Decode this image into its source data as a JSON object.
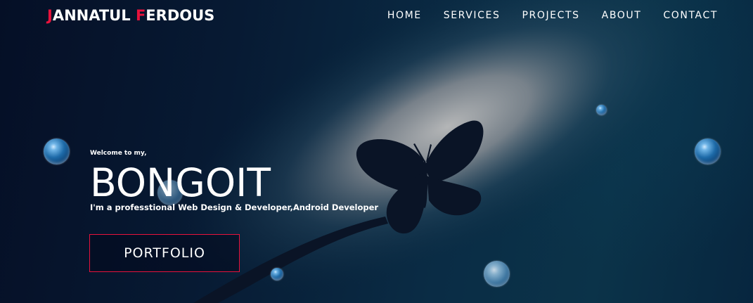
{
  "brand": {
    "first_initial": "J",
    "first_rest": "ANNATUL ",
    "last_initial": "F",
    "last_rest": "ERDOUS",
    "accent_color": "#e8123c"
  },
  "nav": {
    "items": [
      {
        "label": "HOME"
      },
      {
        "label": "SERVICES"
      },
      {
        "label": "PROJECTS"
      },
      {
        "label": "ABOUT"
      },
      {
        "label": "CONTACT"
      }
    ]
  },
  "hero": {
    "welcome": "Welcome to my,",
    "title": "BONGOIT",
    "subtitle": "I'm a professtional Web Design & Developer,Android Developer",
    "button_label": "PORTFOLIO"
  },
  "colors": {
    "background": "#06122a",
    "text": "#ffffff",
    "button_border": "#e8123c"
  }
}
